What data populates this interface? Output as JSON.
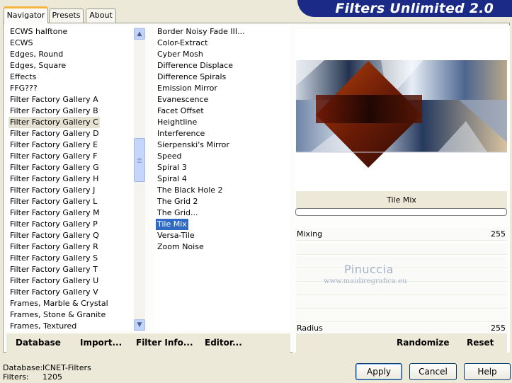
{
  "app_title": "Filters Unlimited 2.0",
  "tabs": [
    "Navigator",
    "Presets",
    "About"
  ],
  "categories": [
    "ECWS halftone",
    "ECWS",
    "Edges, Round",
    "Edges, Square",
    "Effects",
    "FFG???",
    "Filter Factory Gallery A",
    "Filter Factory Gallery B",
    "Filter Factory Gallery C",
    "Filter Factory Gallery D",
    "Filter Factory Gallery E",
    "Filter Factory Gallery F",
    "Filter Factory Gallery G",
    "Filter Factory Gallery H",
    "Filter Factory Gallery J",
    "Filter Factory Gallery L",
    "Filter Factory Gallery M",
    "Filter Factory Gallery P",
    "Filter Factory Gallery Q",
    "Filter Factory Gallery R",
    "Filter Factory Gallery S",
    "Filter Factory Gallery T",
    "Filter Factory Gallery U",
    "Filter Factory Gallery V",
    "Frames, Marble & Crystal",
    "Frames, Stone & Granite",
    "Frames, Textured"
  ],
  "selected_category": "Filter Factory Gallery C",
  "filters": [
    "Border Noisy Fade III...",
    "Color-Extract",
    "Cyber Mosh",
    "Difference Displace",
    "Difference Spirals",
    "Emission Mirror",
    "Evanescence",
    "Facet Offset",
    "Heightline",
    "Interference",
    "Sierpenski's Mirror",
    "Speed",
    "Spiral 3",
    "Spiral 4",
    "The Black Hole 2",
    "The Grid 2",
    "The Grid...",
    "Tile Mix",
    "Versa-Tile",
    "Zoom Noise"
  ],
  "selected_filter": "Tile Mix",
  "preview_filter_name": "Tile Mix",
  "params": [
    {
      "label": "Mixing",
      "value": "255"
    },
    {
      "label": "Radius",
      "value": "255"
    }
  ],
  "watermark": {
    "line1": "Pinuccia",
    "line2": "www.maidiregrafica.eu"
  },
  "left_buttons": [
    "Database",
    "Import...",
    "Filter Info...",
    "Editor..."
  ],
  "right_buttons": [
    "Randomize",
    "Reset"
  ],
  "status": {
    "database_label": "Database:",
    "database_value": "ICNET-Filters",
    "filters_label": "Filters:",
    "filters_value": "1205"
  },
  "dialog_buttons": [
    "Apply",
    "Cancel",
    "Help"
  ],
  "colors": {
    "banner": "#1b2a86",
    "selection": "#316ac5",
    "tab_accent": "#f5b53f"
  },
  "scrollbar_icons": [
    "chevron-up-icon",
    "chevron-down-icon"
  ]
}
